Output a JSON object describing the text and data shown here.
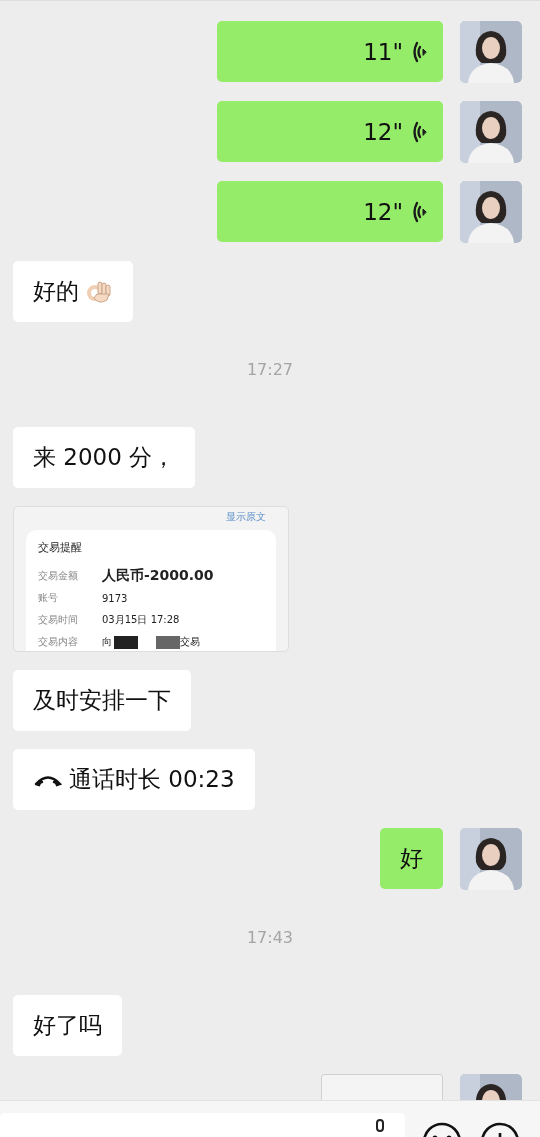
{
  "messages": [
    {
      "kind": "voice",
      "outgoing": true,
      "duration": "11\""
    },
    {
      "kind": "voice",
      "outgoing": true,
      "duration": "12\""
    },
    {
      "kind": "voice",
      "outgoing": true,
      "duration": "12\""
    },
    {
      "kind": "text",
      "outgoing": false,
      "text": "好的",
      "ok_hand": true
    },
    {
      "kind": "time",
      "text": "17:27"
    },
    {
      "kind": "text",
      "outgoing": false,
      "text": "来 2000 分，"
    },
    {
      "kind": "receipt",
      "outgoing": false,
      "link": "显示原文",
      "title": "交易提醒",
      "fields": [
        {
          "label": "交易金额",
          "value": "人民币-2000.00",
          "big": true
        },
        {
          "label": "账号",
          "value": "9173",
          "big": false
        },
        {
          "label": "交易时间",
          "value": "03月15日 17:28",
          "big": false
        },
        {
          "label": "交易内容",
          "value": "向",
          "big": false,
          "redacted": true,
          "tail": "交易"
        }
      ]
    },
    {
      "kind": "text",
      "outgoing": false,
      "text": "及时安排一下"
    },
    {
      "kind": "call",
      "outgoing": false,
      "text": "通话时长 00:23"
    },
    {
      "kind": "text",
      "outgoing": true,
      "text": "好"
    },
    {
      "kind": "time",
      "text": "17:43"
    },
    {
      "kind": "text",
      "outgoing": false,
      "text": "好了吗"
    },
    {
      "kind": "image",
      "outgoing": true
    }
  ]
}
